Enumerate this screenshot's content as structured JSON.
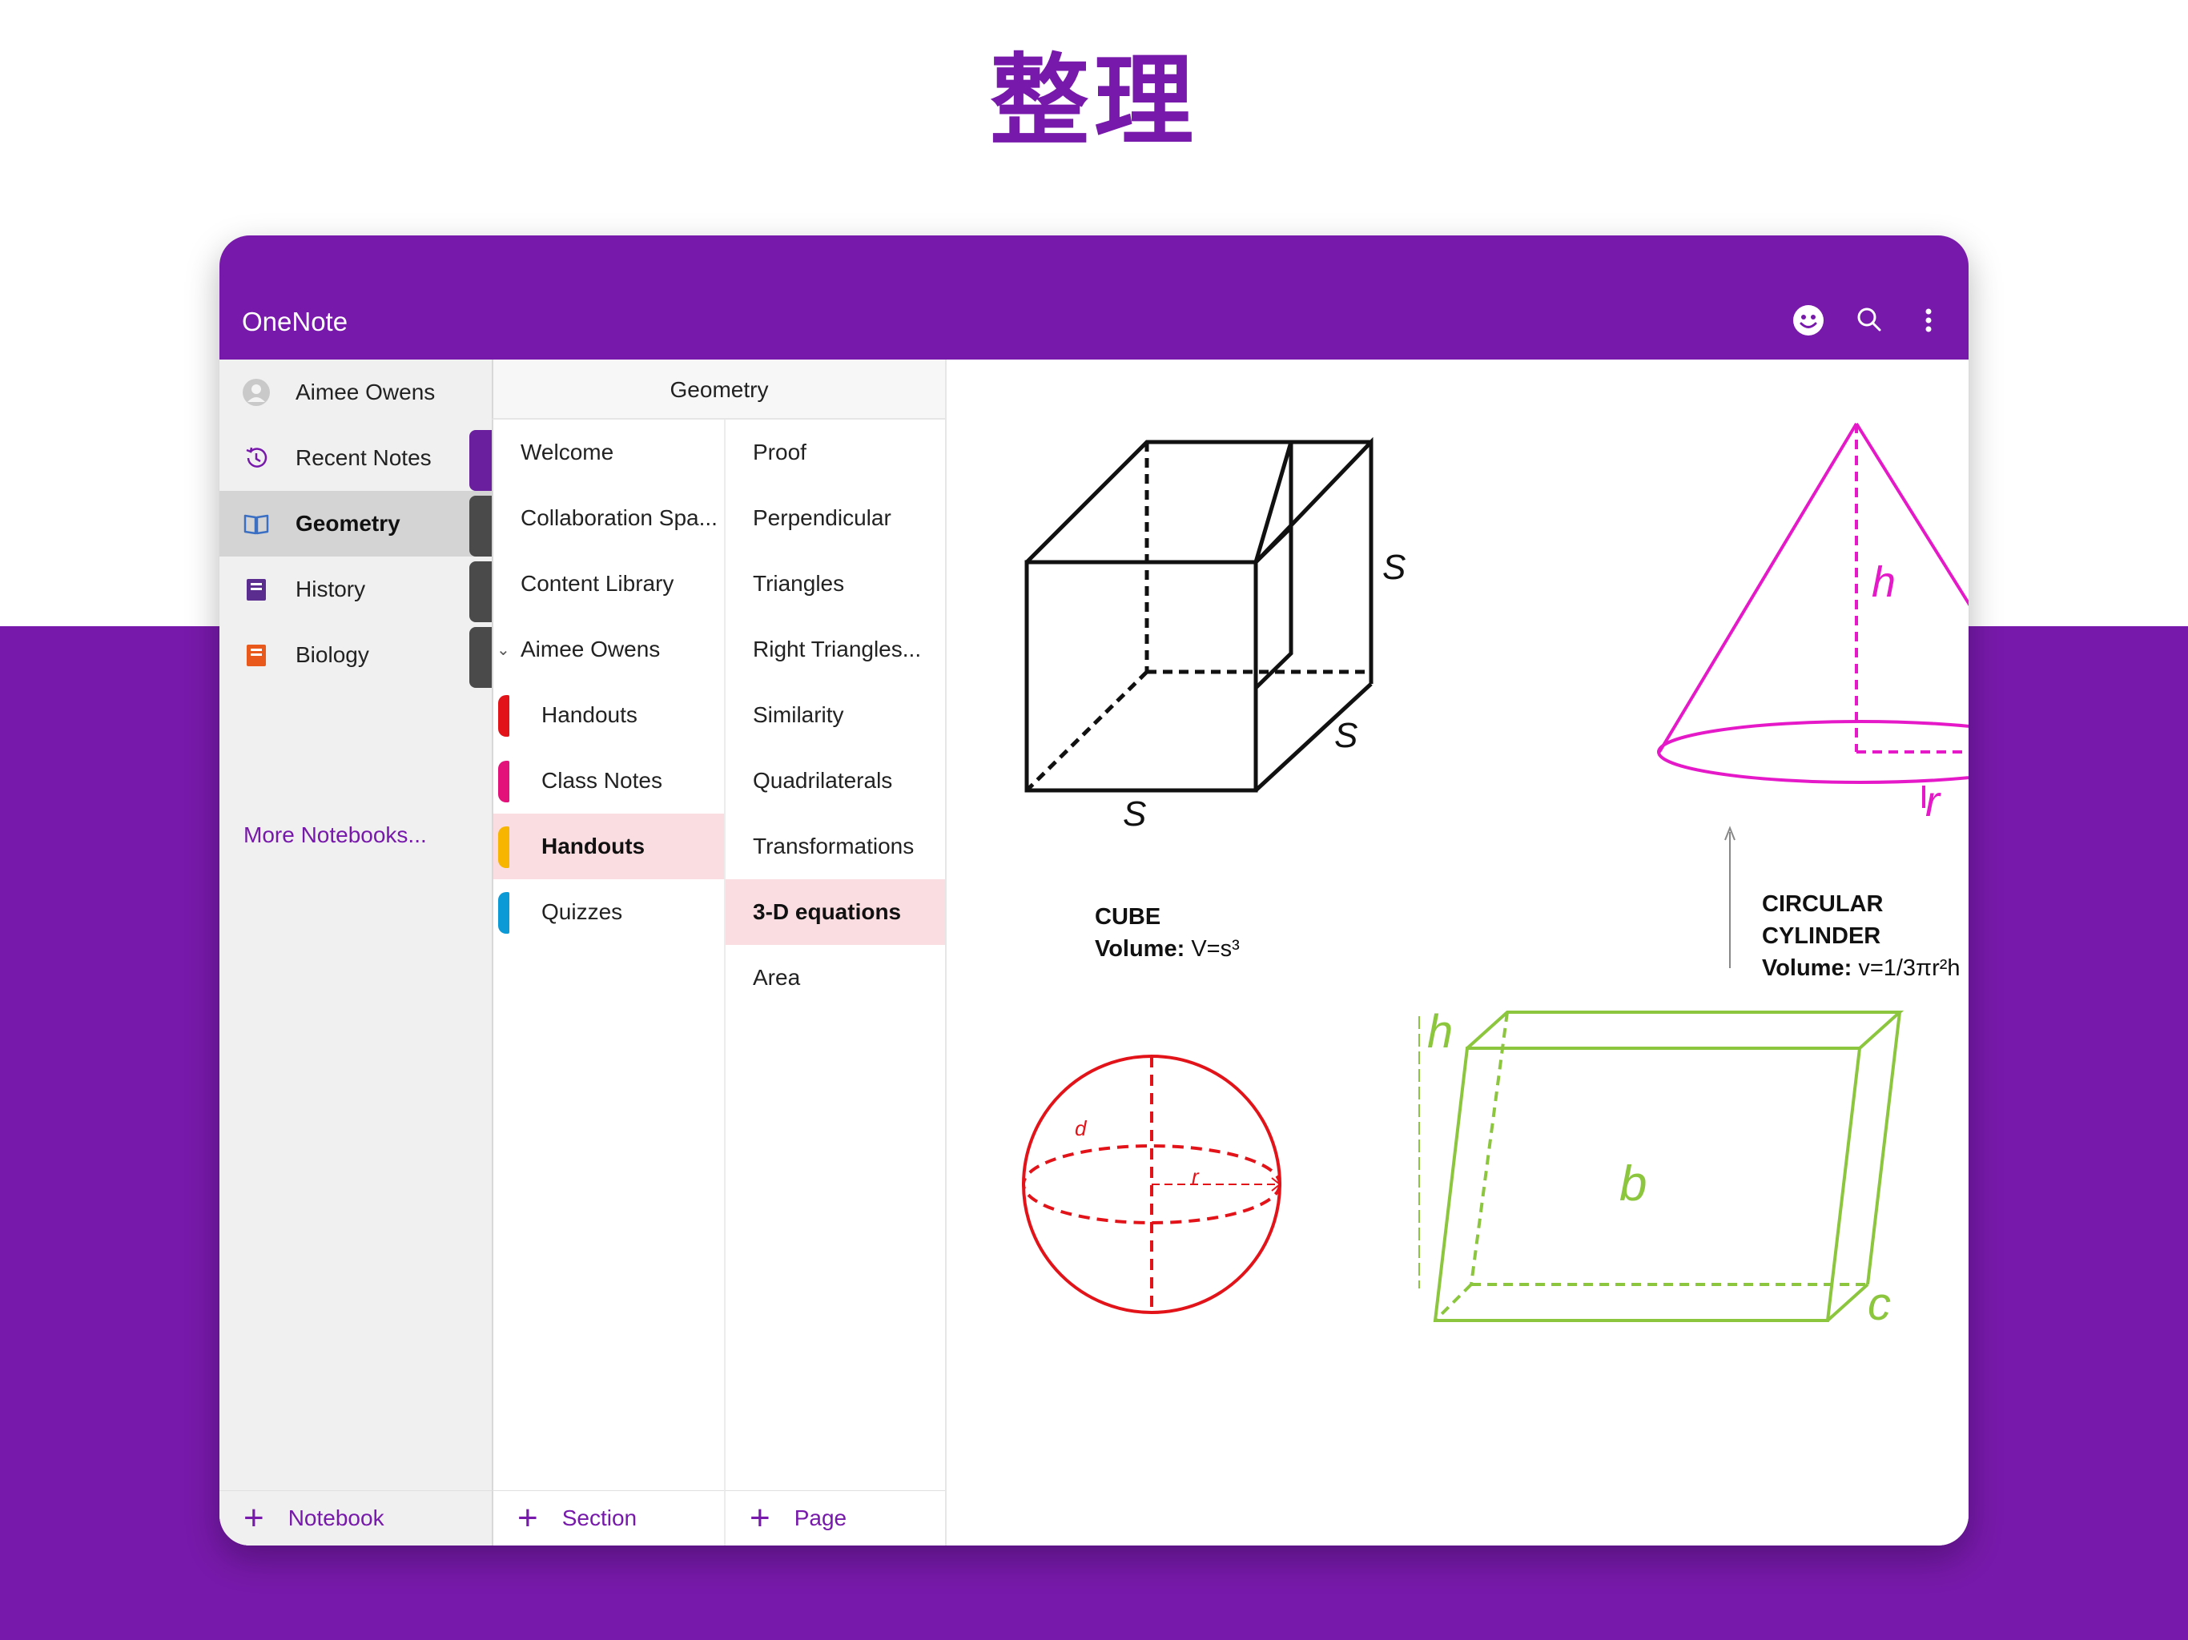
{
  "hero": {
    "title": "整理"
  },
  "app": {
    "title": "OneNote",
    "toolbar": {
      "feedback_icon": "smiley-icon",
      "search_icon": "search-icon",
      "more_icon": "more-vertical-icon"
    }
  },
  "notebooks": {
    "user": "Aimee Owens",
    "recent": "Recent Notes",
    "items": [
      {
        "label": "Geometry",
        "icon": "open-book-icon",
        "active": true,
        "color": "#3a6fc4"
      },
      {
        "label": "History",
        "icon": "notebook-icon",
        "active": false,
        "color": "#5b2d8e"
      },
      {
        "label": "Biology",
        "icon": "notebook-icon",
        "active": false,
        "color": "#e8591b"
      }
    ],
    "more_link": "More Notebooks...",
    "add_label": "Notebook"
  },
  "sections": {
    "header": "Geometry",
    "items": [
      {
        "label": "Welcome"
      },
      {
        "label": "Collaboration Spa..."
      },
      {
        "label": "Content Library"
      },
      {
        "label": "Aimee Owens",
        "group": true
      },
      {
        "label": "Handouts",
        "color": "#e3131a"
      },
      {
        "label": "Class Notes",
        "color": "#e3127a"
      },
      {
        "label": "Handouts",
        "color": "#f7b500",
        "active": true
      },
      {
        "label": "Quizzes",
        "color": "#0b9ad6"
      }
    ],
    "add_label": "Section"
  },
  "pages": {
    "items": [
      {
        "label": "Proof"
      },
      {
        "label": "Perpendicular"
      },
      {
        "label": "Triangles"
      },
      {
        "label": "Right Triangles..."
      },
      {
        "label": "Similarity"
      },
      {
        "label": "Quadrilaterals"
      },
      {
        "label": "Transformations"
      },
      {
        "label": "3-D equations",
        "active": true
      },
      {
        "label": "Area"
      }
    ],
    "add_label": "Page"
  },
  "canvas": {
    "cube": {
      "label_s1": "S",
      "label_s2": "S",
      "label_s3": "S",
      "title": "CUBE",
      "volume_label": "Volume:",
      "volume_formula": "V=s³"
    },
    "cone": {
      "label_h": "h",
      "label_r": "r",
      "title": "CIRCULAR CYLINDER",
      "volume_label": "Volume:",
      "volume_formula": "v=1/3πr²h"
    },
    "sphere": {
      "label_d": "d",
      "label_r": "r"
    },
    "prism": {
      "label_h": "h",
      "label_b": "b",
      "label_c": "c"
    }
  },
  "colors": {
    "brand": "#7719aa",
    "cone": "#e619c9",
    "sphere": "#e3131a",
    "prism": "#8cc63e",
    "active_row": "#fadde1"
  }
}
